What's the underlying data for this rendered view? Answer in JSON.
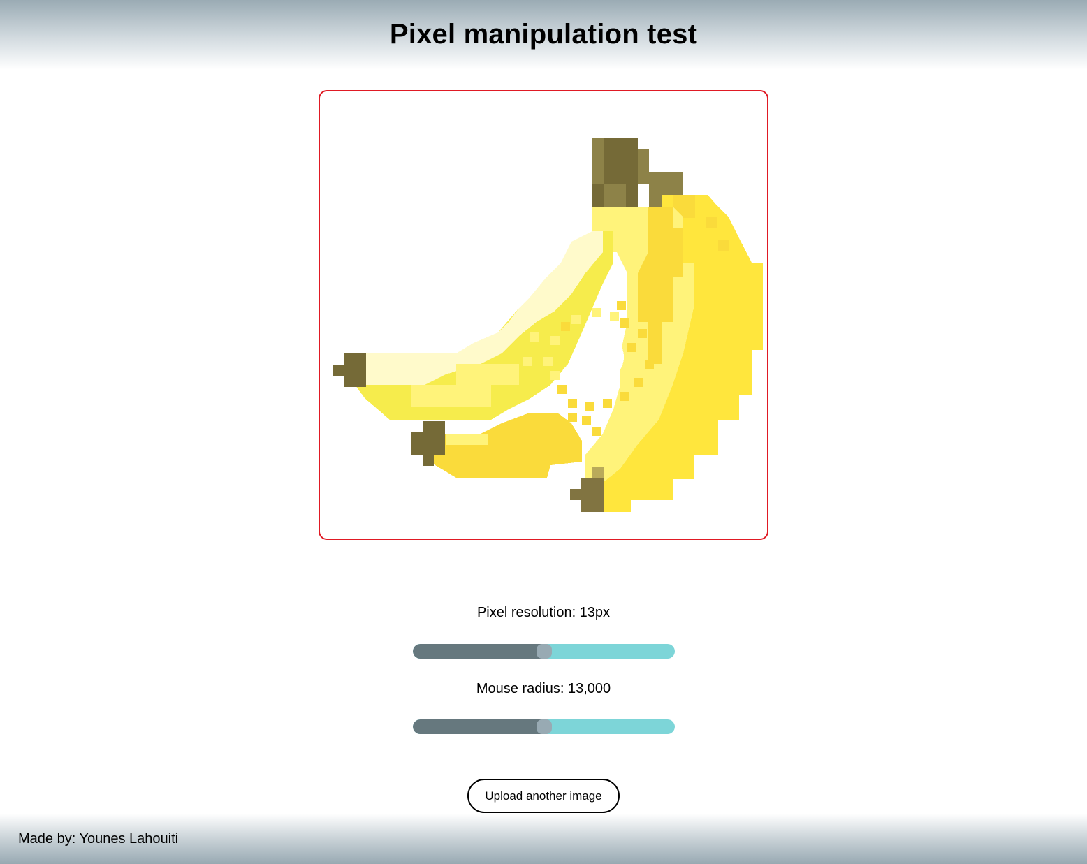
{
  "header": {
    "title": "Pixel manipulation test"
  },
  "canvas": {
    "accent_border_color": "#e01a24",
    "subject": "pixelated banana bunch",
    "palette": {
      "stem_dark": "#756a37",
      "stem_mid": "#8d8248",
      "pale": "#fffacb",
      "light": "#fff37a",
      "mid": "#f6ec4c",
      "gold": "#fadb3b",
      "bright": "#ffe63d"
    }
  },
  "controls": {
    "resolution": {
      "label": "Pixel resolution: 13px",
      "value_fraction": 0.5
    },
    "radius": {
      "label": "Mouse radius: 13,000",
      "value_fraction": 0.5
    },
    "slider_colors": {
      "filled": "#66787e",
      "track": "#7dd5d8",
      "thumb": "#98aab3"
    },
    "upload_label": "Upload another image"
  },
  "footer": {
    "credit": "Made by: Younes Lahouiti"
  }
}
